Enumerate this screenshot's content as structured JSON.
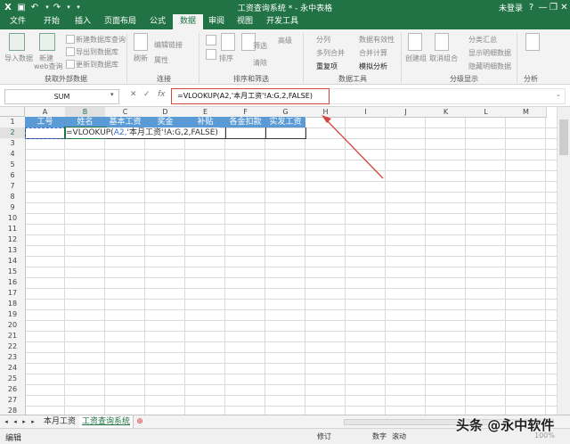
{
  "window": {
    "title": "工资查询系统 * - 永中表格",
    "login_label": "未登录",
    "quick_access": {
      "undo_icon": "↶",
      "redo_icon": "↷"
    },
    "controls": {
      "help": "?",
      "minimize": "—",
      "restore": "❐",
      "close": "✕"
    }
  },
  "tabs": [
    {
      "label": "文件"
    },
    {
      "label": "开始"
    },
    {
      "label": "插入"
    },
    {
      "label": "页面布局"
    },
    {
      "label": "公式"
    },
    {
      "label": "数据"
    },
    {
      "label": "审阅"
    },
    {
      "label": "视图"
    },
    {
      "label": "开发工具"
    }
  ],
  "active_tab": "数据",
  "ribbon": {
    "get_external": {
      "label": "获取外部数据",
      "import_data": "导入数据",
      "new_web_query": "新建",
      "new_web_query_2": "web查询",
      "new_db_query": "新建数据库查询",
      "export_to_db": "导出到数据库",
      "update_to_db": "更新到数据库"
    },
    "connections": {
      "label": "连接",
      "refresh": "刷新",
      "edit_links": "编辑链接",
      "properties": "属性"
    },
    "sort_filter": {
      "label": "排序和筛选",
      "sort": "排序",
      "filter": "筛选",
      "advanced": "高级",
      "clear": "清除"
    },
    "data_tools": {
      "label": "数据工具",
      "split": "分列",
      "multi_merge": "多列合并",
      "duplicates": "重复项",
      "validation": "数据有效性",
      "consolidate": "合并计算",
      "simulation": "模拟分析"
    },
    "outline": {
      "label": "分级显示",
      "group": "创建组",
      "ungroup": "取消组合",
      "subtotal": "分类汇总",
      "show_detail": "显示明细数据",
      "hide_detail": "隐藏明细数据"
    },
    "analysis": {
      "label": "分析",
      "analyze": "分析"
    }
  },
  "formula_bar": {
    "name_box": "SUM",
    "formula": "=VLOOKUP(A2,'本月工资'!A:G,2,FALSE)",
    "cancel_icon": "✕",
    "enter_icon": "✓",
    "fx_label": "fx"
  },
  "columns": [
    "A",
    "B",
    "C",
    "D",
    "E",
    "F",
    "G",
    "H",
    "I",
    "J",
    "K",
    "L",
    "M"
  ],
  "rows": [
    "1",
    "2",
    "3",
    "4",
    "5",
    "6",
    "7",
    "8",
    "9",
    "10",
    "11",
    "12",
    "13",
    "14",
    "15",
    "16",
    "17",
    "18",
    "19",
    "20",
    "21",
    "22",
    "23",
    "24",
    "25",
    "26",
    "27",
    "28"
  ],
  "header_row": [
    "工号",
    "姓名",
    "基本工资",
    "奖金",
    "补贴",
    "各金扣款",
    "实发工资"
  ],
  "editing": {
    "cell_text_prefix": "=VLOOKUP(",
    "cell_text_ref": "A2,",
    "cell_text_rest": "'本月工资'!A:G,2,FALSE)"
  },
  "sheets": [
    {
      "name": "本月工资",
      "active": false
    },
    {
      "name": "工资查询系统",
      "active": true
    }
  ],
  "status": {
    "mode": "编辑",
    "revise": "修订",
    "numeric": "数字",
    "scroll": "滚动",
    "zoom": "100%"
  },
  "watermark": "头条 @永中软件",
  "colors": {
    "title_bar": "#217346",
    "header_fill": "#5b9bd5",
    "annotation": "#d6443e"
  }
}
